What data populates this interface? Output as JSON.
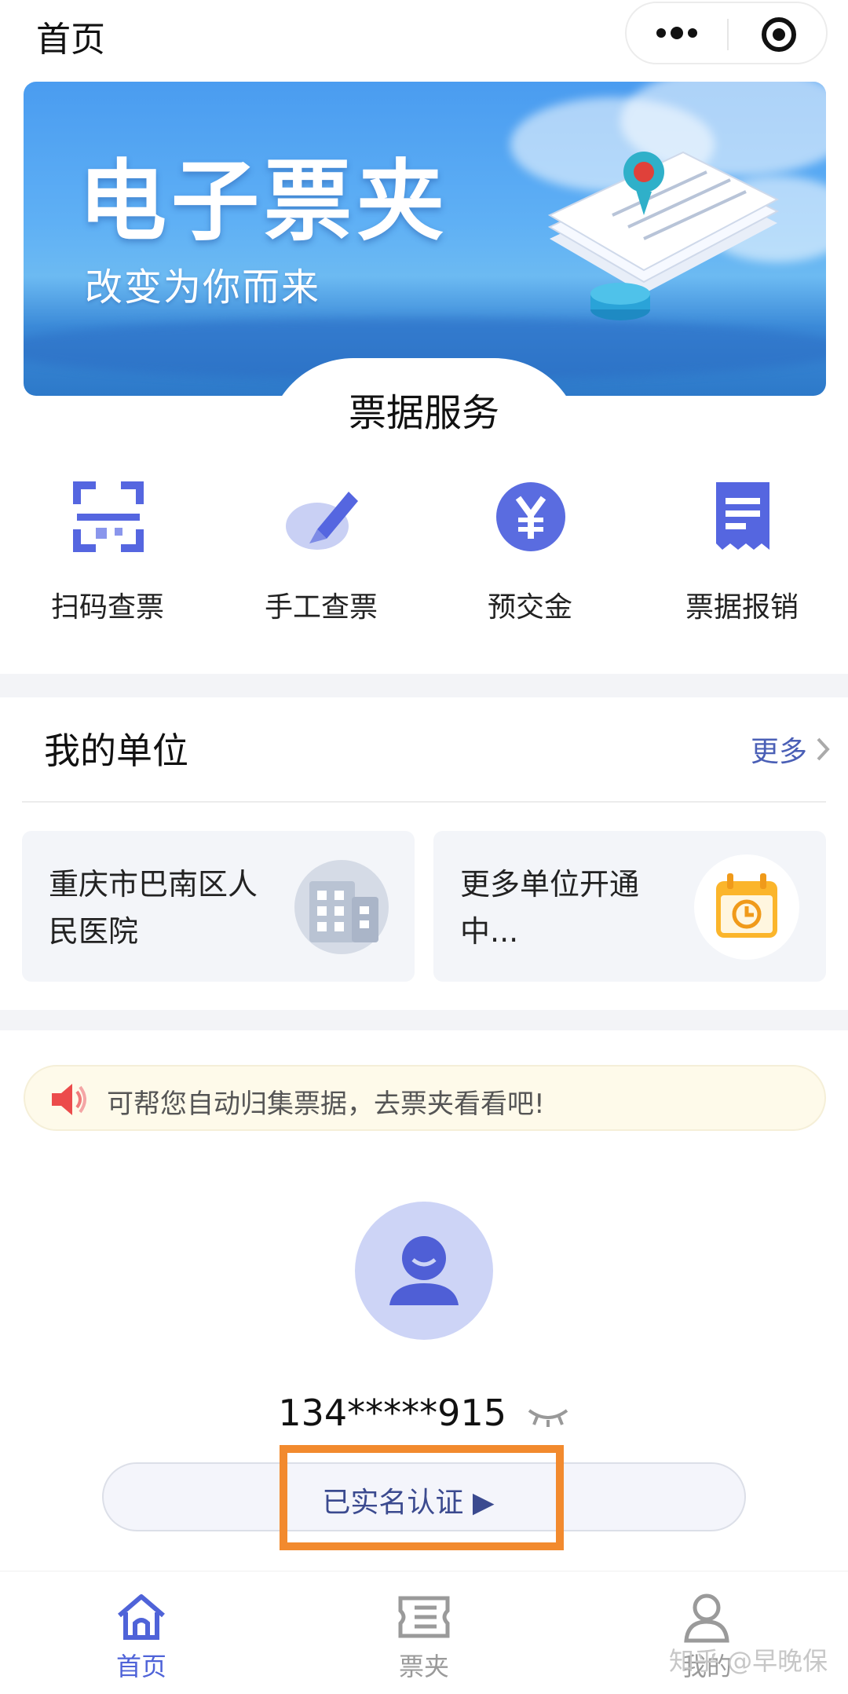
{
  "header": {
    "title": "首页",
    "more_icon": "more-dots-icon",
    "close_icon": "target-close-icon"
  },
  "banner": {
    "title": "电子票夹",
    "subtitle": "改变为你而来"
  },
  "services_section": {
    "title": "票据服务",
    "items": [
      {
        "label": "扫码查票",
        "icon": "scan-icon"
      },
      {
        "label": "手工查票",
        "icon": "pen-icon"
      },
      {
        "label": "预交金",
        "icon": "yen-icon"
      },
      {
        "label": "票据报销",
        "icon": "receipt-icon"
      }
    ]
  },
  "units": {
    "title": "我的单位",
    "more_label": "更多",
    "cards": [
      {
        "name": "重庆市巴南区人民医院",
        "icon": "building-icon"
      },
      {
        "name": "更多单位开通中...",
        "icon": "calendar-clock-icon"
      }
    ]
  },
  "notice": {
    "text": "可帮您自动归集票据，去票夹看看吧!",
    "icon": "speaker-icon"
  },
  "user": {
    "phone": "134*****915",
    "auth_label": "已实名认证 ▶"
  },
  "tabbar": {
    "items": [
      {
        "label": "首页",
        "icon": "home-icon",
        "active": true
      },
      {
        "label": "票夹",
        "icon": "ticket-folder-icon",
        "active": false
      },
      {
        "label": "我的",
        "icon": "user-icon",
        "active": false
      }
    ]
  },
  "watermark": "知乎 @早晚保",
  "colors": {
    "accent": "#4f63d8",
    "highlight": "#f28a2e",
    "inactive": "#9a9a9a"
  }
}
